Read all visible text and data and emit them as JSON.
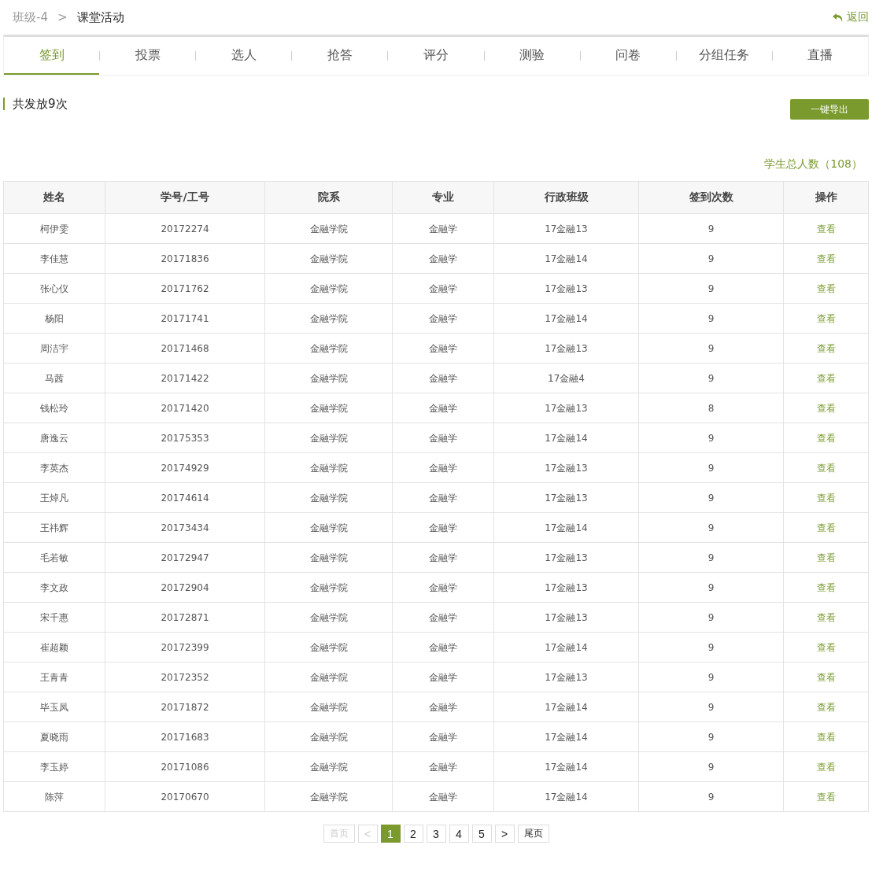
{
  "breadcrumb": {
    "parent": "班级-4",
    "separator": ">",
    "current": "课堂活动"
  },
  "back_link": "返回",
  "tabs": [
    {
      "label": "签到",
      "selected": true
    },
    {
      "label": "投票",
      "selected": false
    },
    {
      "label": "选人",
      "selected": false
    },
    {
      "label": "抢答",
      "selected": false
    },
    {
      "label": "评分",
      "selected": false
    },
    {
      "label": "测验",
      "selected": false
    },
    {
      "label": "问卷",
      "selected": false
    },
    {
      "label": "分组任务",
      "selected": false
    },
    {
      "label": "直播",
      "selected": false
    }
  ],
  "summary": "共发放9次",
  "export_button": "一键导出",
  "total_students": "学生总人数（108）",
  "table": {
    "columns": [
      "姓名",
      "学号/工号",
      "院系",
      "专业",
      "行政班级",
      "签到次数",
      "操作"
    ],
    "rows": [
      [
        "柯伊雯",
        "20172274",
        "金融学院",
        "金融学",
        "17金融13",
        "9",
        "查看"
      ],
      [
        "李佳慧",
        "20171836",
        "金融学院",
        "金融学",
        "17金融14",
        "9",
        "查看"
      ],
      [
        "张心仪",
        "20171762",
        "金融学院",
        "金融学",
        "17金融13",
        "9",
        "查看"
      ],
      [
        "杨阳",
        "20171741",
        "金融学院",
        "金融学",
        "17金融14",
        "9",
        "查看"
      ],
      [
        "周洁宇",
        "20171468",
        "金融学院",
        "金融学",
        "17金融13",
        "9",
        "查看"
      ],
      [
        "马茜",
        "20171422",
        "金融学院",
        "金融学",
        "17金融4",
        "9",
        "查看"
      ],
      [
        "钱松玲",
        "20171420",
        "金融学院",
        "金融学",
        "17金融13",
        "8",
        "查看"
      ],
      [
        "唐逸云",
        "20175353",
        "金融学院",
        "金融学",
        "17金融14",
        "9",
        "查看"
      ],
      [
        "李英杰",
        "20174929",
        "金融学院",
        "金融学",
        "17金融13",
        "9",
        "查看"
      ],
      [
        "王焯凡",
        "20174614",
        "金融学院",
        "金融学",
        "17金融13",
        "9",
        "查看"
      ],
      [
        "王祎辉",
        "20173434",
        "金融学院",
        "金融学",
        "17金融14",
        "9",
        "查看"
      ],
      [
        "毛若敏",
        "20172947",
        "金融学院",
        "金融学",
        "17金融13",
        "9",
        "查看"
      ],
      [
        "李文政",
        "20172904",
        "金融学院",
        "金融学",
        "17金融13",
        "9",
        "查看"
      ],
      [
        "宋千惠",
        "20172871",
        "金融学院",
        "金融学",
        "17金融13",
        "9",
        "查看"
      ],
      [
        "崔超颖",
        "20172399",
        "金融学院",
        "金融学",
        "17金融14",
        "9",
        "查看"
      ],
      [
        "王青青",
        "20172352",
        "金融学院",
        "金融学",
        "17金融13",
        "9",
        "查看"
      ],
      [
        "毕玉凤",
        "20171872",
        "金融学院",
        "金融学",
        "17金融14",
        "9",
        "查看"
      ],
      [
        "夏晓雨",
        "20171683",
        "金融学院",
        "金融学",
        "17金融14",
        "9",
        "查看"
      ],
      [
        "李玉婷",
        "20171086",
        "金融学院",
        "金融学",
        "17金融14",
        "9",
        "查看"
      ],
      [
        "陈萍",
        "20170670",
        "金融学院",
        "金融学",
        "17金融14",
        "9",
        "查看"
      ]
    ]
  },
  "pagination": [
    {
      "label": "首页",
      "selected": false,
      "disabled": true
    },
    {
      "label": "<",
      "selected": false,
      "disabled": true
    },
    {
      "label": "1",
      "selected": true,
      "disabled": false
    },
    {
      "label": "2",
      "selected": false,
      "disabled": false
    },
    {
      "label": "3",
      "selected": false,
      "disabled": false
    },
    {
      "label": "4",
      "selected": false,
      "disabled": false
    },
    {
      "label": "5",
      "selected": false,
      "disabled": false
    },
    {
      "label": ">",
      "selected": false,
      "disabled": false
    },
    {
      "label": "尾页",
      "selected": false,
      "disabled": false
    }
  ]
}
